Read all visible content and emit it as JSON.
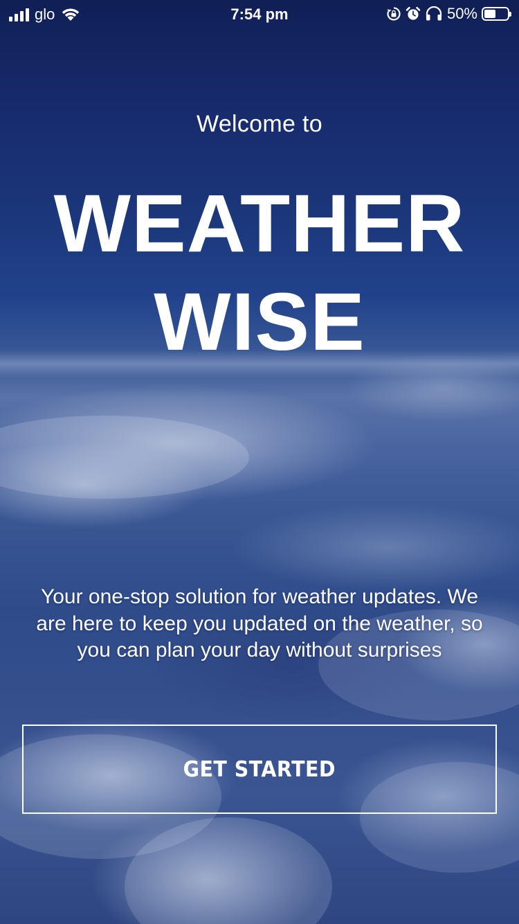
{
  "status_bar": {
    "carrier": "glo",
    "time": "7:54 pm",
    "battery_percent": "50%",
    "battery_level": 0.5,
    "icons": [
      "signal-icon",
      "wifi-icon",
      "orientation-lock-icon",
      "alarm-icon",
      "headphones-icon",
      "battery-icon"
    ]
  },
  "welcome": {
    "prefix": "Welcome to",
    "title_line1": "WEATHER",
    "title_line2": "WISE",
    "tagline": "Your one-stop solution for weather updates. We are here to keep you updated on the weather, so you can plan your day without surprises",
    "cta_label": "GET STARTED"
  },
  "colors": {
    "text": "#ffffff",
    "background_top": "#101f55",
    "background_bottom": "#2e4682"
  }
}
